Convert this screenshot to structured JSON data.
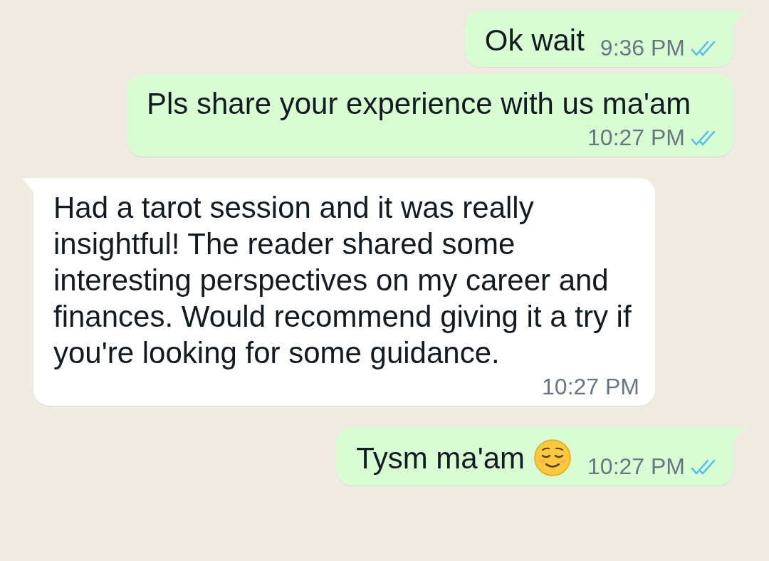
{
  "messages": [
    {
      "kind": "outgoing",
      "tail": true,
      "text": "Ok wait",
      "time": "9:36 PM",
      "read": true,
      "emoji": false
    },
    {
      "kind": "outgoing",
      "tail": false,
      "text": "Pls share your experience with us ma'am",
      "time": "10:27 PM",
      "read": true,
      "emoji": false
    },
    {
      "kind": "incoming",
      "tail": true,
      "text": "Had a tarot session and it was really insightful! The reader shared some interesting perspectives on my career and finances. Would recommend giving it a try if you're looking for some guidance.",
      "time": "10:27 PM",
      "emoji": false
    },
    {
      "kind": "outgoing",
      "tail": true,
      "text": "Tysm ma'am",
      "time": "10:27 PM",
      "read": true,
      "emoji": true
    }
  ]
}
